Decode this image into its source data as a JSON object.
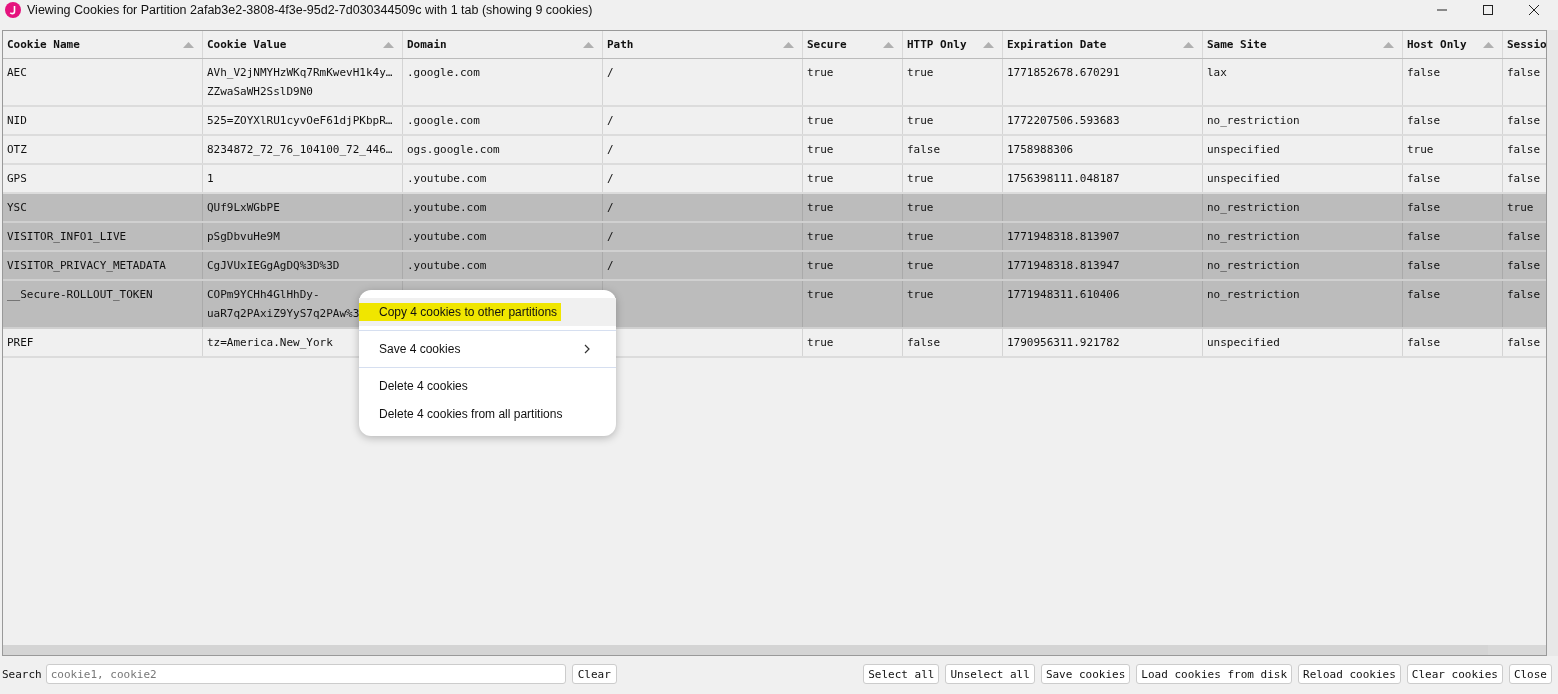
{
  "window": {
    "title": "Viewing Cookies for Partition 2afab3e2-3808-4f3e-95d2-7d030344509c with 1 tab (showing 9 cookies)"
  },
  "table": {
    "columns": [
      "Cookie Name",
      "Cookie Value",
      "Domain",
      "Path",
      "Secure",
      "HTTP Only",
      "Expiration Date",
      "Same Site",
      "Host Only",
      "Sessio"
    ],
    "rows": [
      {
        "selected": false,
        "cells": [
          "AEC",
          "AVh_V2jNMYHzWKq7RmKwevH1k4y…\nZZwaSaWH2SslD9N0",
          ".google.com",
          "/",
          "true",
          "true",
          "1771852678.670291",
          "lax",
          "false",
          "false"
        ]
      },
      {
        "selected": false,
        "cells": [
          "NID",
          "525=ZOYXlRU1cyvOeF61djPKbpR…",
          ".google.com",
          "/",
          "true",
          "true",
          "1772207506.593683",
          "no_restriction",
          "false",
          "false"
        ]
      },
      {
        "selected": false,
        "cells": [
          "OTZ",
          "8234872_72_76_104100_72_446…",
          "ogs.google.com",
          "/",
          "true",
          "false",
          "1758988306",
          "unspecified",
          "true",
          "false"
        ]
      },
      {
        "selected": false,
        "cells": [
          "GPS",
          "1",
          ".youtube.com",
          "/",
          "true",
          "true",
          "1756398111.048187",
          "unspecified",
          "false",
          "false"
        ]
      },
      {
        "selected": true,
        "cells": [
          "YSC",
          "QUf9LxWGbPE",
          ".youtube.com",
          "/",
          "true",
          "true",
          null,
          "no_restriction",
          "false",
          "true"
        ]
      },
      {
        "selected": true,
        "cells": [
          "VISITOR_INFO1_LIVE",
          "pSgDbvuHe9M",
          ".youtube.com",
          "/",
          "true",
          "true",
          "1771948318.813907",
          "no_restriction",
          "false",
          "false"
        ]
      },
      {
        "selected": true,
        "cells": [
          "VISITOR_PRIVACY_METADATA",
          "CgJVUxIEGgAgDQ%3D%3D",
          ".youtube.com",
          "/",
          "true",
          "true",
          "1771948318.813947",
          "no_restriction",
          "false",
          "false"
        ]
      },
      {
        "selected": true,
        "cells": [
          "__Secure-ROLLOUT_TOKEN",
          "COPm9YCHh4GlHhDy-\nuaR7q2PAxiZ9YyS7q2PAw%3",
          null,
          null,
          "true",
          "true",
          "1771948311.610406",
          "no_restriction",
          "false",
          "false"
        ]
      },
      {
        "selected": false,
        "cells": [
          "PREF",
          "tz=America.New_York",
          null,
          null,
          "true",
          "false",
          "1790956311.921782",
          "unspecified",
          "false",
          "false"
        ]
      }
    ]
  },
  "context_menu": {
    "groups": [
      [
        {
          "label": "Copy 4 cookies to other partitions",
          "selected": true,
          "highlighted": true,
          "submenu": false
        }
      ],
      [
        {
          "label": "Save 4 cookies",
          "selected": false,
          "highlighted": false,
          "submenu": true
        }
      ],
      [
        {
          "label": "Delete 4 cookies",
          "selected": false,
          "highlighted": false,
          "submenu": false
        },
        {
          "label": "Delete 4 cookies from all partitions",
          "selected": false,
          "highlighted": false,
          "submenu": false
        }
      ]
    ]
  },
  "search": {
    "label": "Search",
    "placeholder": "cookie1, cookie2",
    "clear": "Clear"
  },
  "buttons": [
    "Select all",
    "Unselect all",
    "Save cookies",
    "Load cookies from disk",
    "Reload cookies",
    "Clear cookies",
    "Close"
  ]
}
